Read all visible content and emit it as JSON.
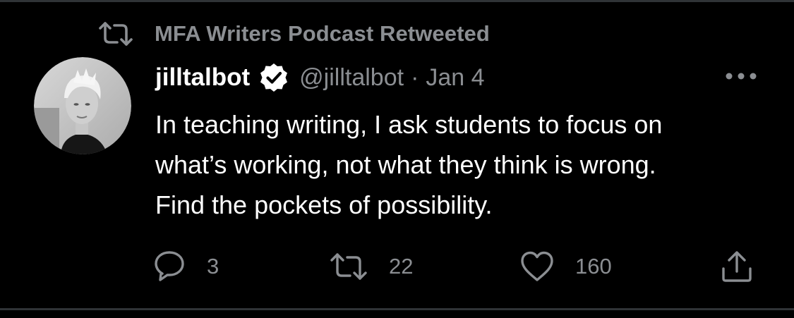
{
  "retweet_context": {
    "text": "MFA Writers Podcast Retweeted",
    "icon": "retweet-icon"
  },
  "tweet": {
    "author": {
      "display_name": "jilltalbot",
      "handle": "@jilltalbot",
      "verified": true,
      "avatar_icon": "avatar-photo"
    },
    "separator": "·",
    "date": "Jan 4",
    "more_icon": "more-horizontal-icon",
    "text_lines": [
      "In teaching writing, I ask students to focus on",
      "what’s working, not what they think is wrong.",
      "Find the pockets of possibility."
    ]
  },
  "actions": {
    "reply": {
      "icon": "reply-icon",
      "count": "3"
    },
    "retweet": {
      "icon": "retweet-icon",
      "count": "22"
    },
    "like": {
      "icon": "heart-icon",
      "count": "160"
    },
    "share": {
      "icon": "share-icon"
    }
  },
  "colors": {
    "background": "#000000",
    "primary_text": "#ffffff",
    "secondary_text": "#8b8e92",
    "divider": "#2f3336"
  }
}
